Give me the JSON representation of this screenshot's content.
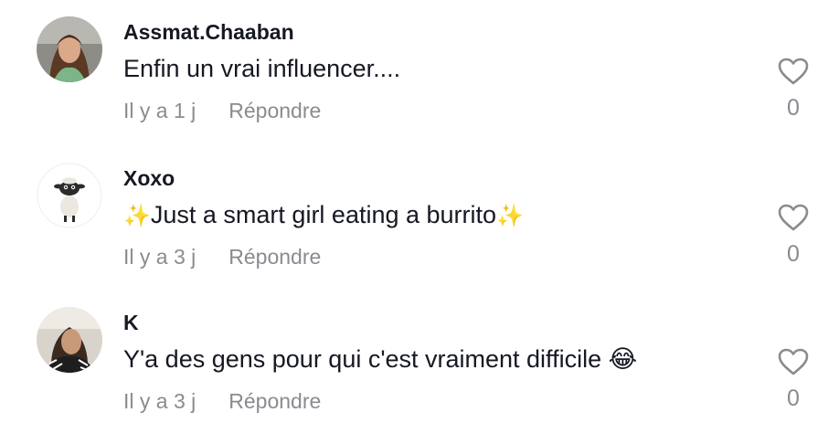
{
  "comments": [
    {
      "username": "Assmat.Chaaban",
      "text": "Enfin un vrai influencer....",
      "time": "Il y a 1 j",
      "reply_label": "Répondre",
      "like_count": "0",
      "avatar_icon": "woman-portrait-avatar"
    },
    {
      "username": "Xoxo",
      "text_prefix": "✨",
      "text": "Just a smart girl eating a burrito",
      "text_suffix": "✨",
      "time": "Il y a 3 j",
      "reply_label": "Répondre",
      "like_count": "0",
      "avatar_icon": "sheep-cartoon-avatar"
    },
    {
      "username": "K",
      "text": "Y'a des gens pour qui c'est vraiment difficile",
      "text_suffix": "😂",
      "time": "Il y a 3 j",
      "reply_label": "Répondre",
      "like_count": "0",
      "avatar_icon": "woman-selfie-avatar"
    }
  ],
  "colors": {
    "text": "#161823",
    "secondary": "#8a8b91",
    "background": "#ffffff"
  }
}
